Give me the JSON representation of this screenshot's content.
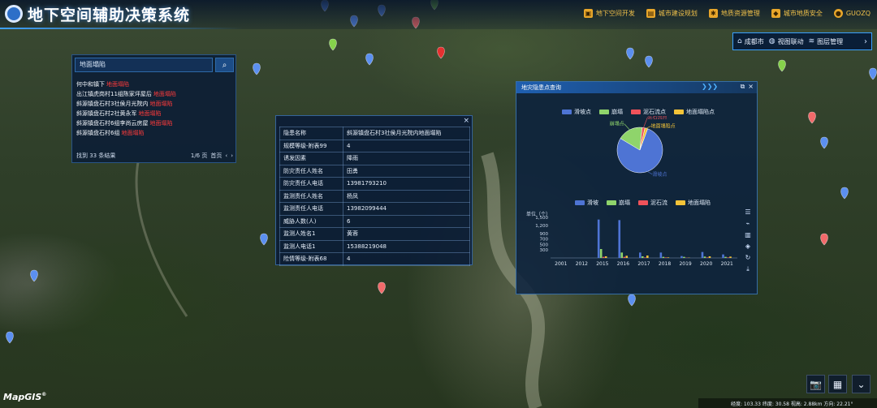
{
  "app": {
    "title": "地下空间辅助决策系统"
  },
  "nav": [
    {
      "label": "地下空间开发",
      "icon": "building-icon"
    },
    {
      "label": "城市建设规划",
      "icon": "city-icon"
    },
    {
      "label": "地质资源管理",
      "icon": "gear-icon"
    },
    {
      "label": "城市地质安全",
      "icon": "shield-icon"
    },
    {
      "label": "GUOZQ",
      "icon": "user-icon"
    }
  ],
  "toolbar": {
    "items": [
      {
        "label": "成都市",
        "icon": "home-icon"
      },
      {
        "label": "视图联动",
        "icon": "globe-icon"
      },
      {
        "label": "图层管理",
        "icon": "layers-icon"
      }
    ]
  },
  "search": {
    "value": "地面塌陷",
    "results": [
      {
        "text": "何中和镇下",
        "tag": "地面塌陷"
      },
      {
        "text": "出江镇虎岗村11组陈家坪屋后",
        "tag": "地面塌陷"
      },
      {
        "text": "斜源镇盘石村3社侯月光院内",
        "tag": "地面塌陷"
      },
      {
        "text": "斜源镇盘石村2社黄永军",
        "tag": "地面塌陷"
      },
      {
        "text": "斜源镇盘石村6组李尚云房屋",
        "tag": "地面塌陷"
      },
      {
        "text": "斜源镇盘石村6组",
        "tag": "地面塌陷"
      }
    ],
    "total": "找到 33 条结果",
    "page": "1/6 页",
    "first_page": "首页",
    "prev": "‹",
    "next": "›"
  },
  "info": {
    "rows": [
      {
        "k": "隐患名称",
        "v": "斜源镇盘石村3社侯月光院内地面塌陷"
      },
      {
        "k": "规模等级-附表99",
        "v": "4"
      },
      {
        "k": "诱发因素",
        "v": "降雨"
      },
      {
        "k": "防灾责任人姓名",
        "v": "田勇"
      },
      {
        "k": "防灾责任人电话",
        "v": "13981793210"
      },
      {
        "k": "监测责任人姓名",
        "v": "杨凤"
      },
      {
        "k": "监测责任人电话",
        "v": "13982099444"
      },
      {
        "k": "威胁人数(人)",
        "v": "6"
      },
      {
        "k": "监测人姓名1",
        "v": "黄蓉"
      },
      {
        "k": "监测人电话1",
        "v": "15388219048"
      },
      {
        "k": "险情等级-附表68",
        "v": "4"
      }
    ]
  },
  "stats": {
    "title": "地灾隐患点查询",
    "chevrons": "❯❯❯",
    "ctrl_min": "⧉",
    "ctrl_close": "×"
  },
  "chart_data": [
    {
      "type": "pie",
      "legend": [
        "滑坡点",
        "崩塌",
        "泥石流点",
        "地面塌陷点"
      ],
      "colors": [
        "#4e74d4",
        "#8fd46b",
        "#f0525a",
        "#f3c338"
      ],
      "values": [
        78,
        18,
        2,
        2
      ],
      "slice_labels": [
        "滑坡点",
        "崩塌点",
        "泥石流点",
        "地面塌陷点"
      ]
    },
    {
      "type": "bar",
      "legend": [
        "滑坡",
        "崩塌",
        "泥石流",
        "地面塌陷"
      ],
      "colors": [
        "#4e74d4",
        "#8fd46b",
        "#f0525a",
        "#f3c338"
      ],
      "ylabel": "单位（个）",
      "ylim": [
        0,
        1500
      ],
      "yticks": [
        300,
        500,
        700,
        900,
        1200,
        1500
      ],
      "ytick_labels": [
        "300",
        "500",
        "700",
        "900",
        "1,200",
        "1,500"
      ],
      "categories": [
        "2001",
        "2012",
        "2015",
        "2016",
        "2017",
        "2018",
        "2019",
        "2020",
        "2021"
      ],
      "series": [
        {
          "name": "滑坡",
          "values": [
            0,
            0,
            1420,
            1400,
            200,
            200,
            70,
            220,
            130
          ]
        },
        {
          "name": "崩塌",
          "values": [
            0,
            0,
            330,
            200,
            60,
            40,
            40,
            50,
            40
          ]
        },
        {
          "name": "泥石流",
          "values": [
            0,
            0,
            40,
            40,
            20,
            20,
            10,
            20,
            20
          ]
        },
        {
          "name": "地面塌陷",
          "values": [
            0,
            0,
            60,
            80,
            90,
            20,
            10,
            60,
            50
          ]
        }
      ]
    }
  ],
  "side_tools": [
    {
      "icon": "list-icon",
      "glyph": "☰"
    },
    {
      "icon": "line-chart-icon",
      "glyph": "⌁"
    },
    {
      "icon": "bar-chart-icon",
      "glyph": "▥"
    },
    {
      "icon": "stack-icon",
      "glyph": "◈"
    },
    {
      "icon": "refresh-icon",
      "glyph": "↻"
    },
    {
      "icon": "download-icon",
      "glyph": "⤓"
    }
  ],
  "controls": {
    "camera": "📷",
    "layout": "▦",
    "expand": "⌄"
  },
  "status": {
    "text": "经度: 103.33 纬度: 30.58 视高: 2.88km 方向: 22.21°"
  },
  "brand": {
    "name": "MapGIS",
    "mark": "®"
  }
}
